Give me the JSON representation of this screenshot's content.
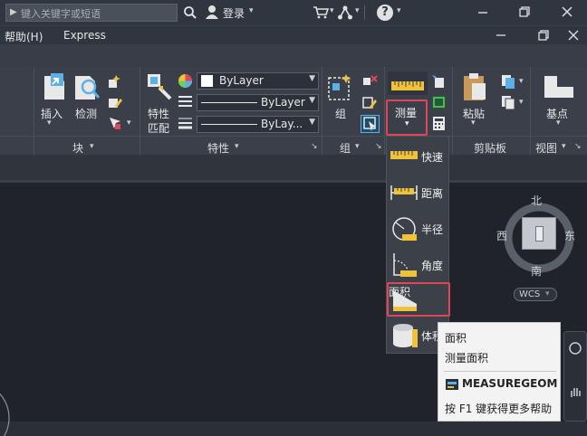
{
  "title_bar": {
    "search_placeholder": "键入关键字或短语",
    "login_label": "登录",
    "help_glyph": "?"
  },
  "menu": {
    "items": [
      "帮助(H)",
      "Express"
    ]
  },
  "ribbon": {
    "insert_label": "插入",
    "inspect_label": "检测",
    "block_group": "块",
    "match_label_1": "特性",
    "match_label_2": "匹配",
    "color_value": "ByLayer",
    "linetype_value": "ByLayer",
    "lineweight_value": "ByLay...",
    "properties_group": "特性",
    "group_label": "组",
    "group_group": "组",
    "measure_label": "测量",
    "paste_label": "粘贴",
    "clipboard_group": "剪贴板",
    "base_label": "基点",
    "view_group": "视图"
  },
  "measure_menu": {
    "items": [
      {
        "label": "快速",
        "icon": "ruler-quick-icon"
      },
      {
        "label": "距离",
        "icon": "distance-icon"
      },
      {
        "label": "半径",
        "icon": "radius-icon"
      },
      {
        "label": "角度",
        "icon": "angle-icon"
      },
      {
        "label": "面积",
        "icon": "area-icon"
      },
      {
        "label": "体积",
        "icon": "volume-icon"
      }
    ],
    "selected": "面积"
  },
  "viewcube": {
    "north": "北",
    "south": "南",
    "east": "东",
    "west": "西",
    "wcs": "WCS"
  },
  "tooltip": {
    "title": "面积",
    "description": "测量面积",
    "command": "MEASUREGEOM",
    "help": "按 F1 键获得更多帮助"
  },
  "colors": {
    "highlight": "#e0455a",
    "ruler_yellow": "#f0c23a",
    "background": "#202329"
  }
}
